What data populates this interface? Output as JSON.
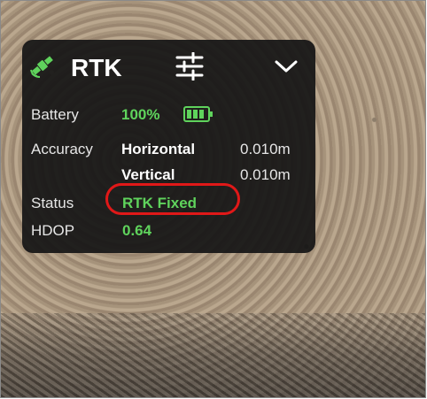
{
  "header": {
    "title": "RTK",
    "icons": {
      "satellite": "satellite-icon",
      "settings": "sliders-icon",
      "collapse": "chevron-down-icon"
    }
  },
  "battery": {
    "label": "Battery",
    "value": "100%",
    "level": 1.0,
    "icon": "battery-icon"
  },
  "accuracy": {
    "label": "Accuracy",
    "horizontal": {
      "label": "Horizontal",
      "value": "0.010m"
    },
    "vertical": {
      "label": "Vertical",
      "value": "0.010m"
    }
  },
  "status": {
    "label": "Status",
    "value": "RTK Fixed"
  },
  "hdop": {
    "label": "HDOP",
    "value": "0.64"
  },
  "colors": {
    "accent_green": "#5fd35c",
    "highlight_red": "#e01818",
    "panel_bg": "#161616"
  }
}
